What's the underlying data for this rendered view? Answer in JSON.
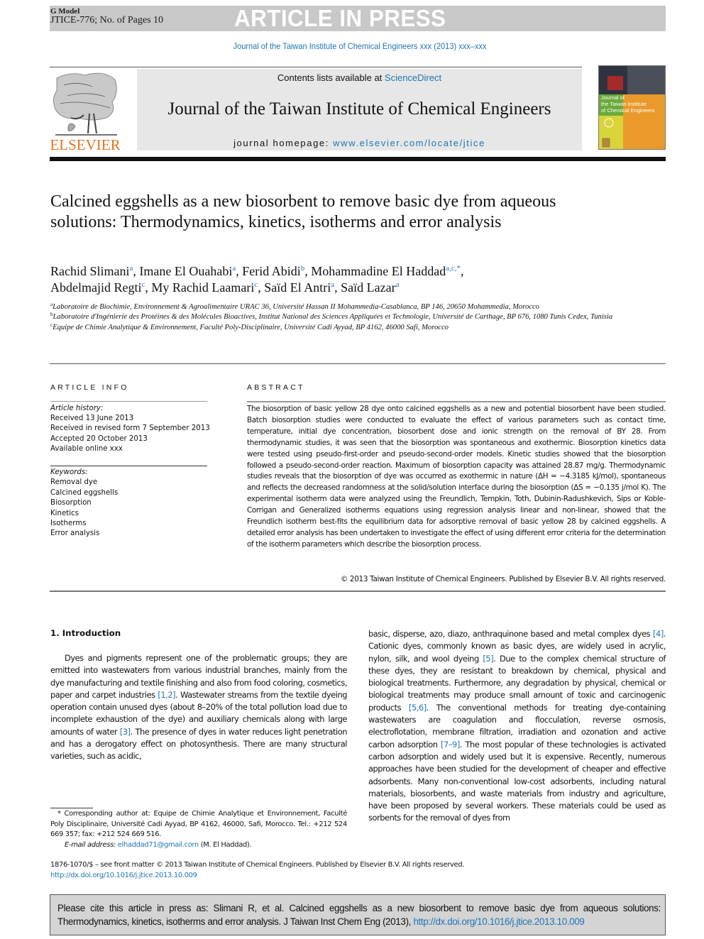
{
  "header": {
    "g_model": "G Model",
    "manuscript_id": "JTICE-776; No. of Pages 10",
    "banner": "ARTICLE IN PRESS",
    "running_head": "Journal of the Taiwan Institute of Chemical Engineers xxx (2013) xxx–xxx"
  },
  "masthead": {
    "publisher_logo": "ELSEVIER",
    "contents_prefix": "Contents lists available at ",
    "contents_link": "ScienceDirect",
    "journal_title": "Journal of the Taiwan Institute of Chemical Engineers",
    "homepage_prefix": "journal homepage: ",
    "homepage_link": "www.elsevier.com/locate/jtice",
    "cover_title_lines": [
      "Journal of",
      "the Taiwan Institute",
      "of Chemical Engineers"
    ]
  },
  "article": {
    "title": "Calcined eggshells as a new biosorbent to remove basic dye from aqueous solutions: Thermodynamics, kinetics, isotherms and error analysis",
    "authors": [
      {
        "name": "Rachid Slimani",
        "aff": "a"
      },
      {
        "name": "Imane El Ouahabi",
        "aff": "a"
      },
      {
        "name": "Ferid Abidi",
        "aff": "b"
      },
      {
        "name": "Mohammadine El Haddad",
        "aff": "a,c,*"
      },
      {
        "name": "Abdelmajid Regti",
        "aff": "c"
      },
      {
        "name": "My Rachid Laamari",
        "aff": "c"
      },
      {
        "name": "Saïd El Antri",
        "aff": "a"
      },
      {
        "name": "Saïd Lazar",
        "aff": "a"
      }
    ],
    "affiliations": [
      {
        "mark": "a",
        "text": "Laboratoire de Biochimie, Environnement & Agroalimentaire URAC 36, Université Hassan II Mohammedia-Casablanca, BP 146, 20650 Mohammedia, Morocco"
      },
      {
        "mark": "b",
        "text": "Laboratoire d'Ingénierie des Protéines & des Molécules Bioactives, Institut National des Sciences Appliquées et Technologie, Université de Carthage, BP 676, 1080 Tunis Cedex, Tunisia"
      },
      {
        "mark": "c",
        "text": "Equipe de Chimie Analytique & Environnement, Faculté Poly-Disciplinaire, Université Cadi Ayyad, BP 4162, 46000 Safi, Morocco"
      }
    ]
  },
  "article_info": {
    "heading": "ARTICLE INFO",
    "history_label": "Article history:",
    "history": [
      "Received 13 June 2013",
      "Received in revised form 7 September 2013",
      "Accepted 20 October 2013",
      "Available online xxx"
    ],
    "keywords_label": "Keywords:",
    "keywords": [
      "Removal dye",
      "Calcined eggshells",
      "Biosorption",
      "Kinetics",
      "Isotherms",
      "Error analysis"
    ]
  },
  "abstract": {
    "heading": "ABSTRACT",
    "text": "The biosorption of basic yellow 28 dye onto calcined eggshells as a new and potential biosorbent have been studied. Batch biosorption studies were conducted to evaluate the effect of various parameters such as contact time, temperature, initial dye concentration, biosorbent dose and ionic strength on the removal of BY 28. From thermodynamic studies, it was seen that the biosorption was spontaneous and exothermic. Biosorption kinetics data were tested using pseudo-first-order and pseudo-second-order models. Kinetic studies showed that the biosorption followed a pseudo-second-order reaction. Maximum of biosorption capacity was attained 28.87 mg/g. Thermodynamic studies reveals that the biosorption of dye was occurred as exothermic in nature (ΔH = −4.3185 kJ/mol), spontaneous and reflects the decreased randomness at the solid/solution interface during the biosorption (ΔS = −0.135 j/mol K). The experimental isotherm data were analyzed using the Freundlich, Tempkin, Toth, Dubinin-Radushkevich, Sips or Koble-Corrigan and Generalized isotherms equations using regression analysis linear and non-linear, showed that the Freundlich isotherm best-fits the equilibrium data for adsorptive removal of basic yellow 28 by calcined eggshells. A detailed error analysis has been undertaken to investigate the effect of using different error criteria for the determination of the isotherm parameters which describe the biosorption process.",
    "copyright": "© 2013 Taiwan Institute of Chemical Engineers. Published by Elsevier B.V. All rights reserved."
  },
  "body": {
    "section_heading": "1. Introduction",
    "left_segments": [
      {
        "t": "Dyes and pigments represent one of the problematic groups; they are emitted into wastewaters from various industrial branches, mainly from the dye manufacturing and textile finishing and also from food coloring, cosmetics, paper and carpet industries "
      },
      {
        "ref": "[1,2]"
      },
      {
        "t": ". Wastewater streams from the textile dyeing operation contain unused dyes (about 8–20% of the total pollution load due to incomplete exhaustion of the dye) and auxiliary chemicals along with large amounts of water "
      },
      {
        "ref": "[3]"
      },
      {
        "t": ". The presence of dyes in water reduces light penetration and has a derogatory effect on photosynthesis. There are many structural varieties, such as acidic,"
      }
    ],
    "right_segments": [
      {
        "t": "basic, disperse, azo, diazo, anthraquinone based and metal complex dyes "
      },
      {
        "ref": "[4]"
      },
      {
        "t": ". Cationic dyes, commonly known as basic dyes, are widely used in acrylic, nylon, silk, and wool dyeing "
      },
      {
        "ref": "[5]"
      },
      {
        "t": ". Due to the complex chemical structure of these dyes, they are resistant to breakdown by chemical, physical and biological treatments. Furthermore, any degradation by physical, chemical or biological treatments may produce small amount of toxic and carcinogenic products "
      },
      {
        "ref": "[5,6]"
      },
      {
        "t": ". The conventional methods for treating dye-containing wastewaters are coagulation and flocculation, reverse osmosis, electroflotation, membrane filtration, irradiation and ozonation and active carbon adsorption "
      },
      {
        "ref": "[7–9]"
      },
      {
        "t": ". The most popular of these technologies is activated carbon adsorption and widely used but it is expensive. Recently, numerous approaches have been studied for the development of cheaper and effective adsorbents. Many non-conventional low-cost adsorbents, including natural materials, biosorbents, and waste materials from industry and agriculture, have been proposed by several workers. These materials could be used as sorbents for the removal of dyes from"
      }
    ]
  },
  "footnote": {
    "corresponding": "* Corresponding author at: Equipe de Chimie Analytique et Environnement, Faculté Poly Disciplinaire, Université Cadi Ayyad, BP 4162, 46000, Safi, Morocco. Tel.: +212 524 669 357; fax: +212 524 669 516.",
    "email_label": "E-mail address: ",
    "email": "elhaddad71@gmail.com",
    "email_suffix": " (M. El Haddad).",
    "issn_line": "1876-1070/$ – see front matter © 2013 Taiwan Institute of Chemical Engineers. Published by Elsevier B.V. All rights reserved.",
    "doi": "http://dx.doi.org/10.1016/j.jtice.2013.10.009"
  },
  "cite_box": {
    "text": "Please cite this article in press as: Slimani R, et al. Calcined eggshells as a new biosorbent to remove basic dye from aqueous solutions: Thermodynamics, kinetics, isotherms and error analysis. J Taiwan Inst Chem Eng (2013), ",
    "doi_link": "http://dx.doi.org/10.1016/j.jtice.2013.10.009"
  },
  "colors": {
    "link": "#1f75b5",
    "elsevier_orange": "#e8731f",
    "banner_gray": "#c8c8c8",
    "masthead_gray": "#e7e7e7"
  }
}
